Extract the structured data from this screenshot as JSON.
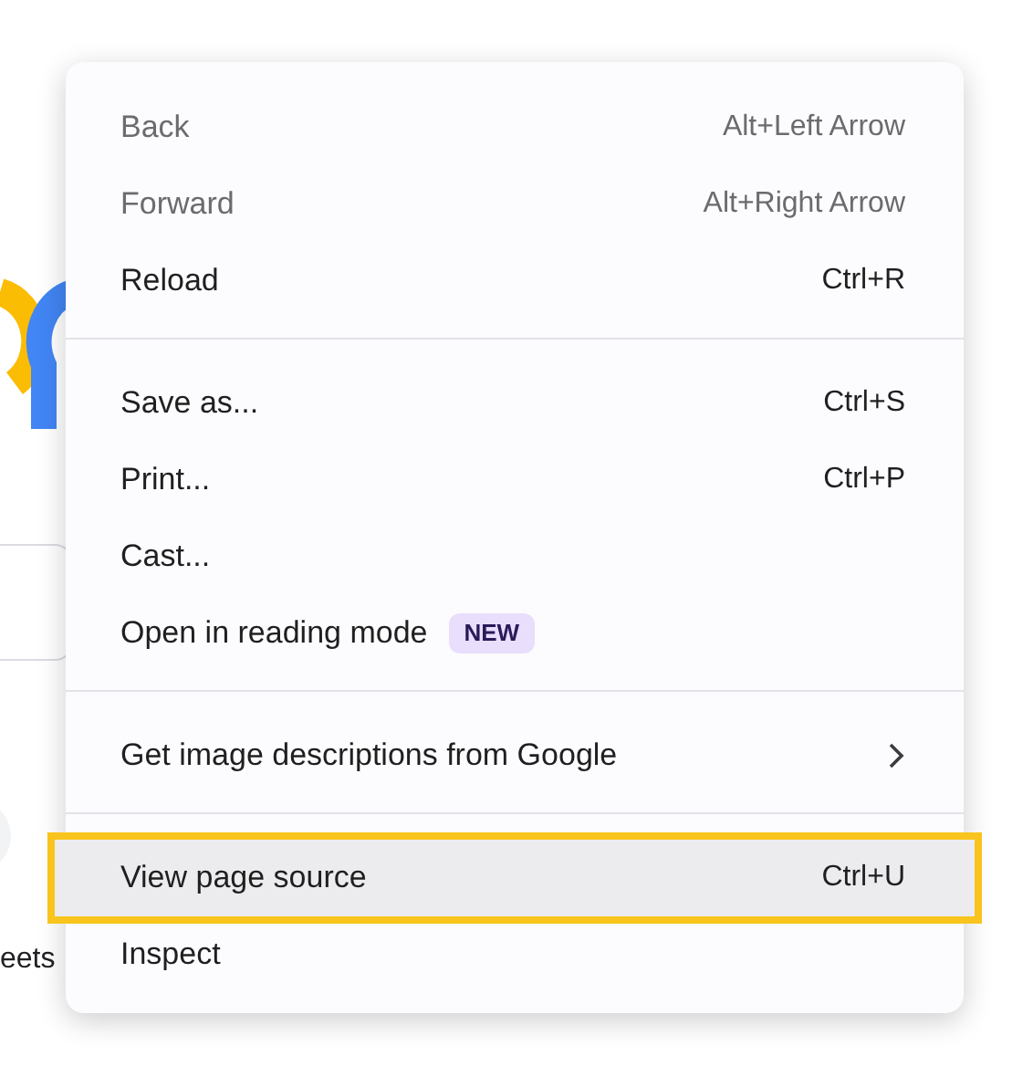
{
  "background": {
    "partial_text": "eets"
  },
  "menu": {
    "sections": [
      {
        "items": [
          {
            "kind": "command",
            "label": "Back",
            "shortcut": "Alt+Left Arrow",
            "disabled": true,
            "selected": false
          },
          {
            "kind": "command",
            "label": "Forward",
            "shortcut": "Alt+Right Arrow",
            "disabled": true,
            "selected": false
          },
          {
            "kind": "command",
            "label": "Reload",
            "shortcut": "Ctrl+R",
            "disabled": false,
            "selected": false
          }
        ]
      },
      {
        "items": [
          {
            "kind": "command",
            "label": "Save as...",
            "shortcut": "Ctrl+S",
            "disabled": false,
            "selected": false
          },
          {
            "kind": "command",
            "label": "Print...",
            "shortcut": "Ctrl+P",
            "disabled": false,
            "selected": false
          },
          {
            "kind": "command",
            "label": "Cast...",
            "disabled": false,
            "selected": false
          },
          {
            "kind": "command",
            "label": "Open in reading mode",
            "badge": "NEW",
            "disabled": false,
            "selected": false
          }
        ]
      },
      {
        "items": [
          {
            "kind": "submenu",
            "label": "Get image descriptions from Google",
            "disabled": false,
            "selected": false
          }
        ]
      },
      {
        "items": [
          {
            "kind": "command",
            "label": "View page source",
            "shortcut": "Ctrl+U",
            "disabled": false,
            "selected": true
          },
          {
            "kind": "command",
            "label": "Inspect",
            "disabled": false,
            "selected": false
          }
        ]
      }
    ]
  }
}
